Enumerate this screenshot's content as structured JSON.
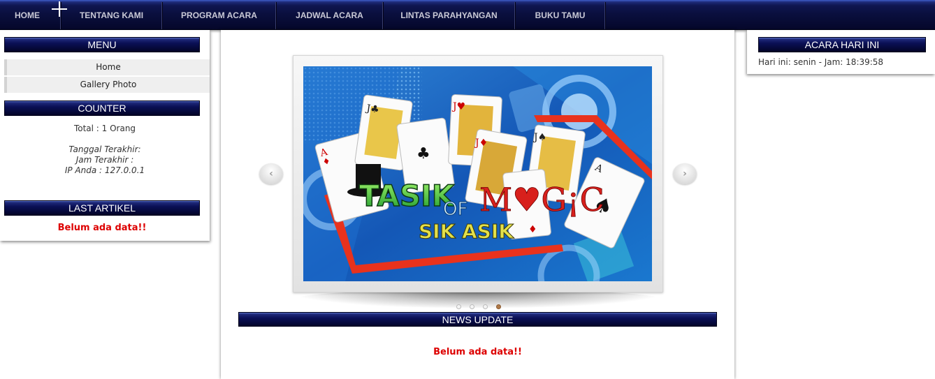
{
  "nav": {
    "items": [
      {
        "label": "HOME"
      },
      {
        "label": "TENTANG KAMI"
      },
      {
        "label": "PROGRAM ACARA"
      },
      {
        "label": "JADWAL ACARA"
      },
      {
        "label": "LINTAS PARAHYANGAN"
      },
      {
        "label": "BUKU TAMU"
      }
    ]
  },
  "left": {
    "menu_title": "MENU",
    "menu_items": [
      {
        "label": "Home"
      },
      {
        "label": "Gallery Photo"
      }
    ],
    "counter_title": "COUNTER",
    "counter_total": "Total : 1 Orang",
    "counter_date": "Tanggal Terakhir:",
    "counter_time": "Jam Terakhir :",
    "counter_ip": "IP Anda : 127.0.0.1",
    "last_article_title": "LAST ARTIKEL",
    "last_article_empty": "Belum ada data!!"
  },
  "center": {
    "slide_title_main": "TASIK",
    "slide_title_of": "OF",
    "slide_title_magic": "M♥G¡C",
    "slide_subtitle": "SIK ASIK",
    "prev_arrow": "‹",
    "next_arrow": "›",
    "slide_count": 4,
    "active_slide": 4,
    "news_title": "NEWS UPDATE",
    "news_empty": "Belum ada data!!"
  },
  "right": {
    "title": "ACARA HARI INI",
    "info": "Hari ini: senin - Jam: 18:39:58"
  },
  "colors": {
    "header_navy": "#050836",
    "accent_red": "#dd0000",
    "active_dot": "#b07a4a"
  }
}
